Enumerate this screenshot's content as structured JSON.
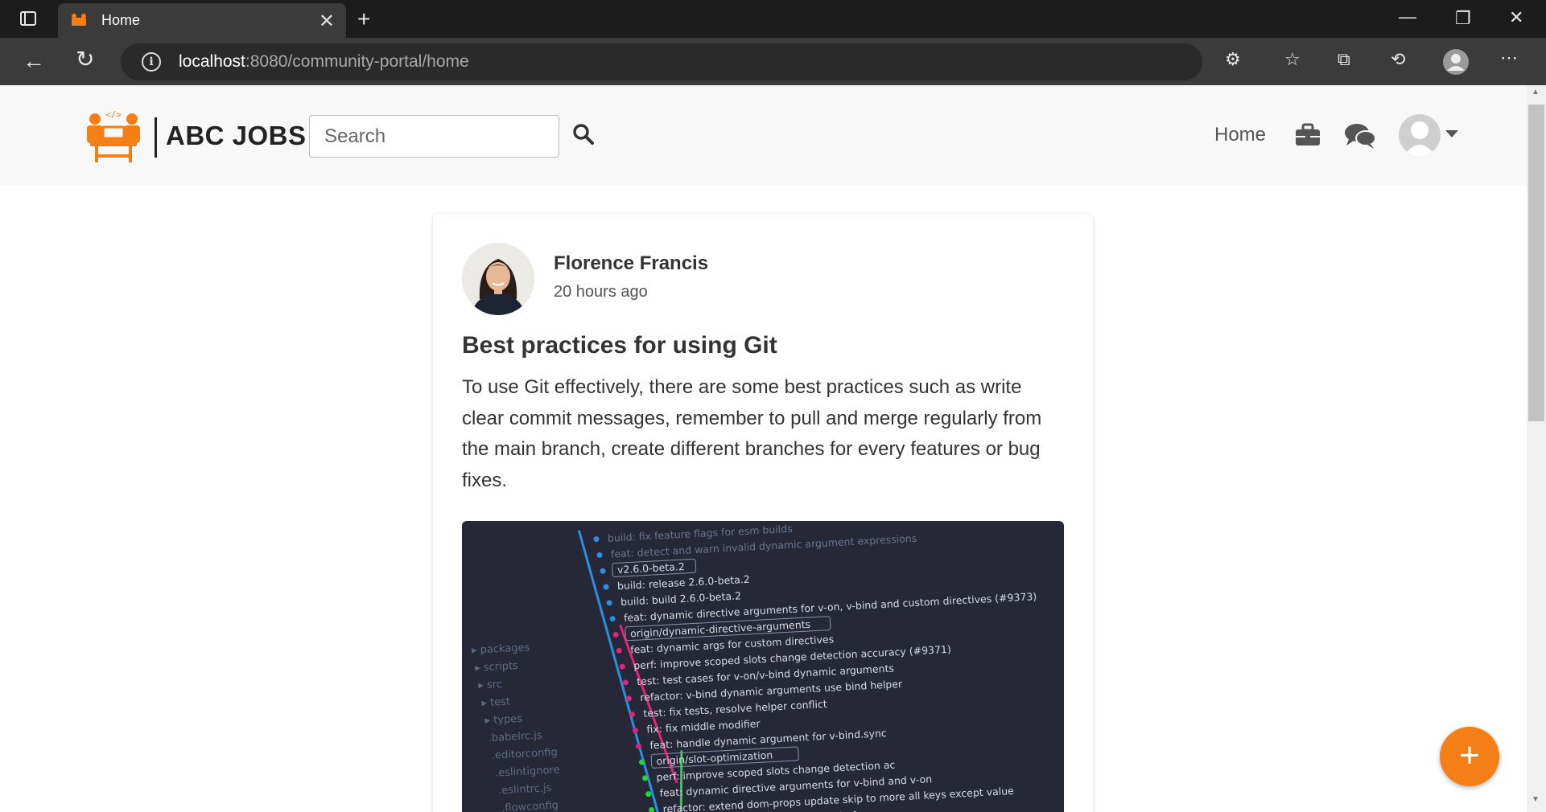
{
  "browser": {
    "tab_title": "Home",
    "url_host": "localhost",
    "url_path": ":8080/community-portal/home"
  },
  "nav": {
    "brand": "ABC JOBS",
    "search_placeholder": "Search",
    "home_label": "Home"
  },
  "post": {
    "author": "Florence Francis",
    "time": "20 hours ago",
    "title": "Best practices for using Git",
    "body": "To use Git effectively, there are some best practices such as write clear commit messages, remember to pull and merge regularly from the main branch, create different branches for every features or bug fixes."
  },
  "code_image": {
    "files": [
      "packages",
      "scripts",
      "src",
      "test",
      "types",
      ".babelrc.js",
      ".editorconfig",
      ".eslintignore",
      ".eslintrc.js",
      ".flowconfig"
    ],
    "commits": [
      "build: fix feature flags for esm builds",
      "feat: detect and warn invalid dynamic argument expressions",
      "v2.6.0-beta.2",
      "build: release 2.6.0-beta.2",
      "build: build 2.6.0-beta.2",
      "feat: dynamic directive arguments for v-on, v-bind and custom directives (#9373)",
      "origin/dynamic-directive-arguments",
      "feat: dynamic args for custom directives",
      "perf: improve scoped slots change detection accuracy (#9371)",
      "test: test cases for v-on/v-bind dynamic arguments",
      "refactor: v-bind dynamic arguments use bind helper",
      "test: fix tests, resolve helper conflict",
      "fix: fix middle modifier",
      "feat: handle dynamic argument for v-bind.sync",
      "origin/slot-optimization",
      "perf: improve scoped slots change detection ac",
      "feat: dynamic directive arguments for v-bind and v-on",
      "refactor: extend dom-props update skip to more all keys except value",
      "fix: checkbox event edge case in Firefox"
    ]
  },
  "colors": {
    "accent": "#f57f17",
    "brand_text": "#222222",
    "chrome_dark": "#1c1c1c"
  }
}
